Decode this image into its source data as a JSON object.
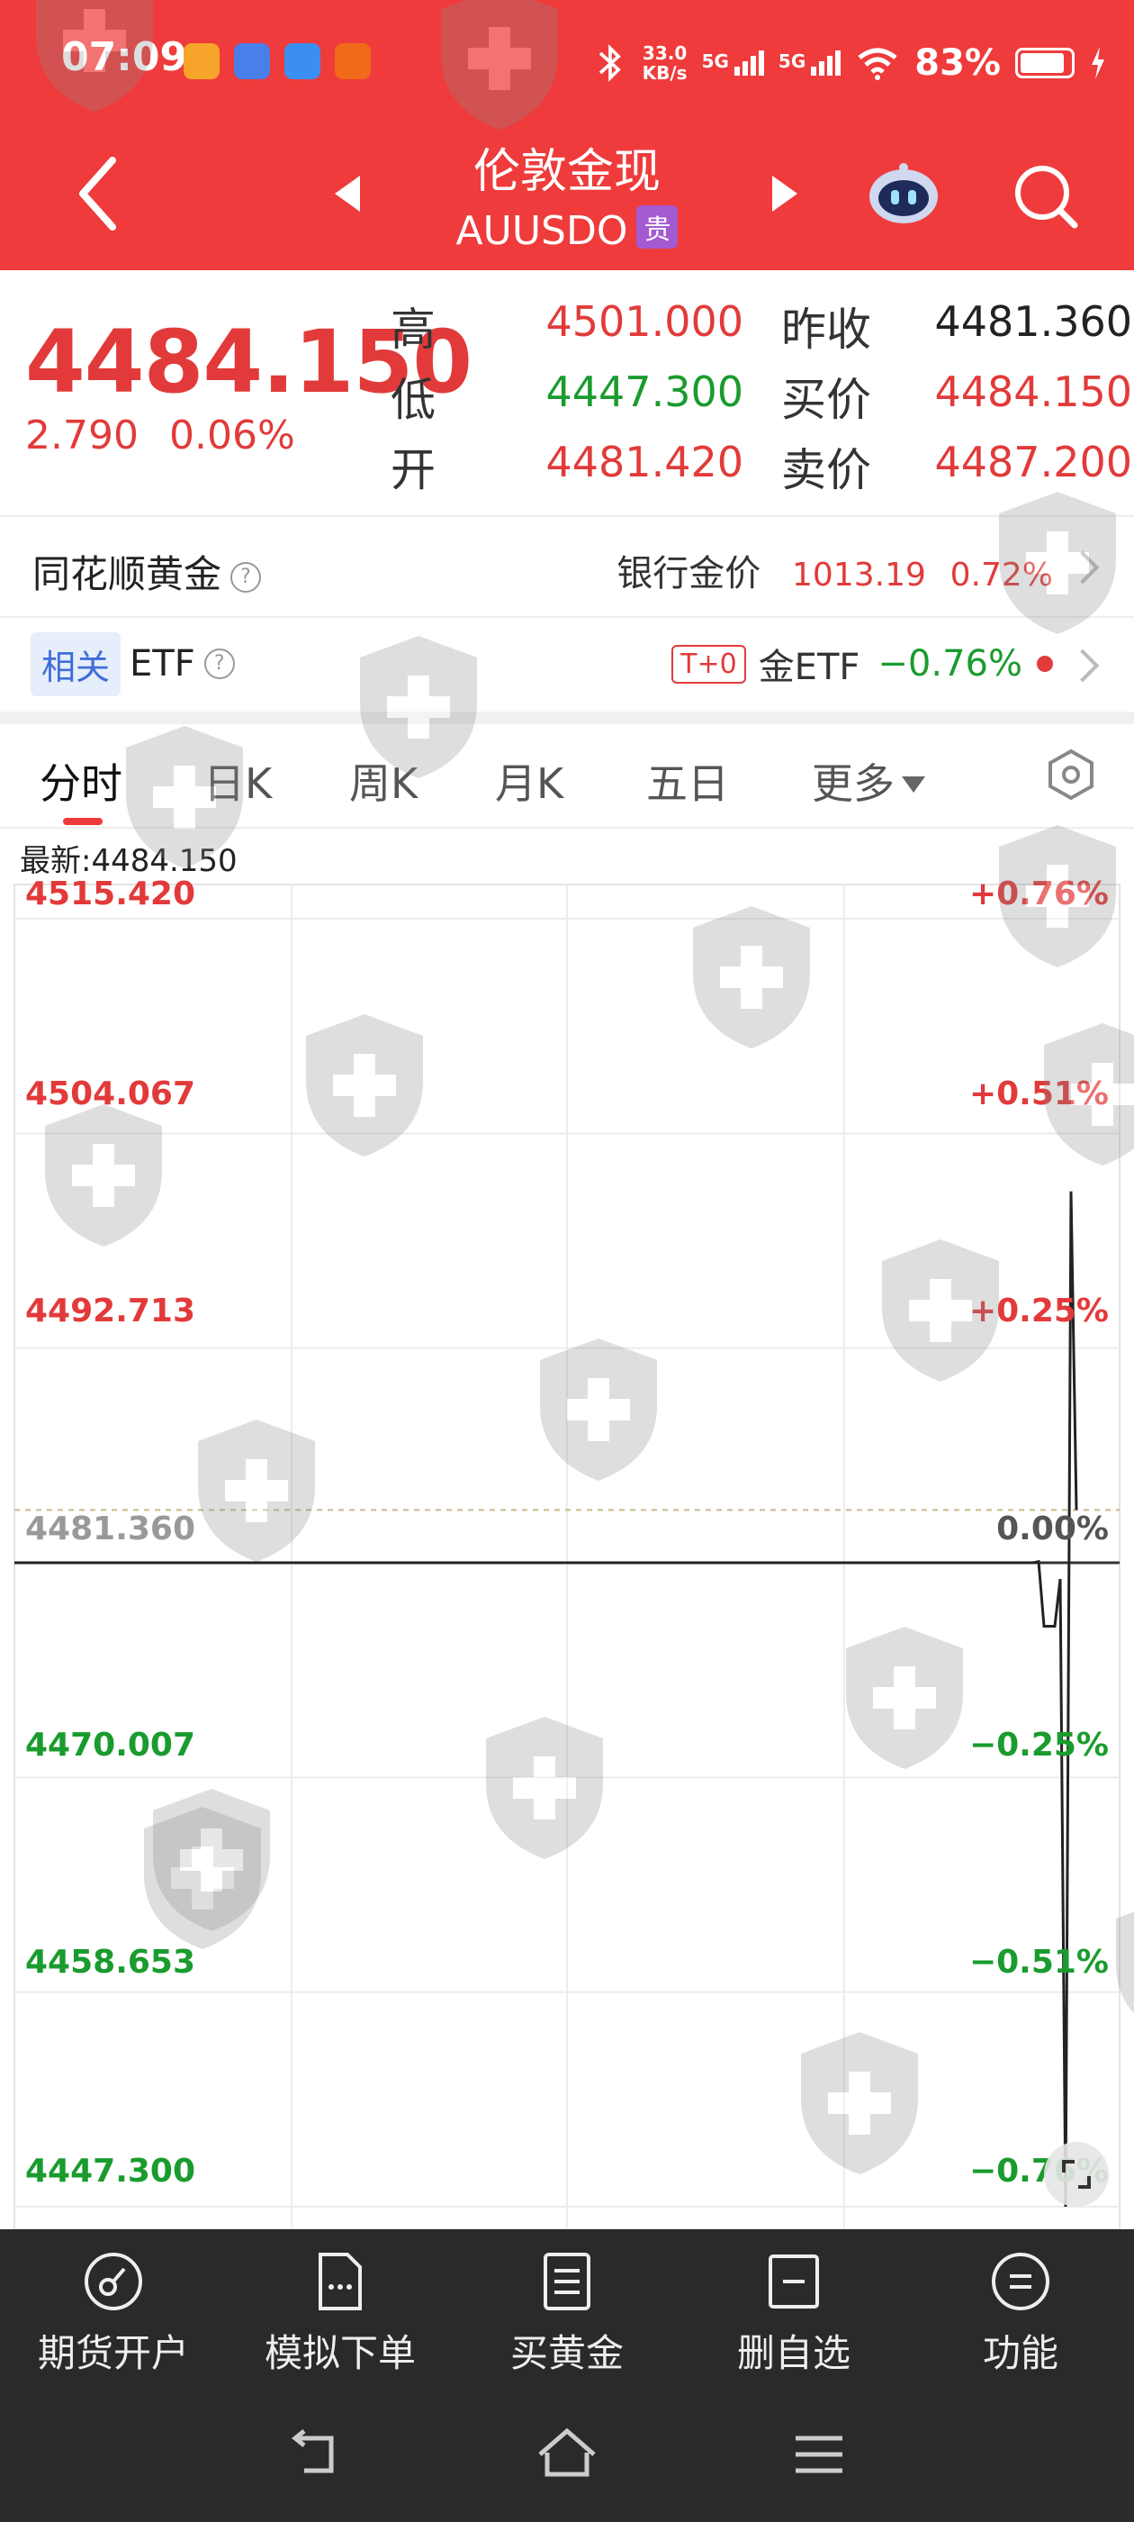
{
  "status_bar": {
    "time": "07:09",
    "net_speed_value": "33.0",
    "net_speed_unit": "KB/s",
    "signal1_label": "5G",
    "signal2_label": "5G",
    "battery": "83%"
  },
  "header": {
    "title": "伦敦金现",
    "subtitle": "AUUSDO",
    "badge": "贵"
  },
  "quote": {
    "last_price": "4484.150",
    "change": "2.790",
    "change_pct": "0.06%",
    "high_label": "高",
    "high": "4501.000",
    "low_label": "低",
    "low": "4447.300",
    "open_label": "开",
    "open": "4481.420",
    "prev_close_label": "昨收",
    "prev_close": "4481.360",
    "bid_label": "买价",
    "bid": "4484.150",
    "ask_label": "卖价",
    "ask": "4487.200"
  },
  "gold_row": {
    "label": "同花顺黄金",
    "bank_label": "银行金价",
    "bank_price": "1013.19",
    "bank_pct": "0.72%"
  },
  "etf_row": {
    "tag": "相关",
    "label": "ETF",
    "t0": "T+0",
    "etf_name": "金ETF",
    "etf_pct": "−0.76%"
  },
  "tabs": [
    "分时",
    "日K",
    "周K",
    "月K",
    "五日",
    "更多"
  ],
  "latest": "最新:4484.150",
  "colors": {
    "up": "#e23a3a",
    "down": "#1a9b2e",
    "header_bg": "#ef3b3b",
    "footer_bg": "#2a2a2a"
  },
  "chart_data": {
    "type": "line",
    "y_labels_left": [
      "4515.420",
      "4504.067",
      "4492.713",
      "4481.360",
      "4470.007",
      "4458.653",
      "4447.300"
    ],
    "y_labels_right": [
      "+0.76%",
      "+0.51%",
      "+0.25%",
      "0.00%",
      "−0.25%",
      "−0.51%",
      "−0.76%"
    ],
    "ylim": [
      4447.3,
      4515.42
    ],
    "reference": 4481.36,
    "average_line": 4484.15,
    "grid": true,
    "series": [
      {
        "values": [
          4481.36,
          4481.36,
          4481.36,
          4481.36,
          4481.36,
          4481.36,
          4481.36,
          4481.36,
          4481.36,
          4481.36,
          4481.36,
          4481.36,
          4481.36,
          4481.36,
          4481.36,
          4481.36,
          4481.36,
          4481.36,
          4481.36,
          4481.36,
          4481.36,
          4481.36,
          4481.36,
          4481.36,
          4481.36,
          4481.36,
          4481.36,
          4481.36,
          4481.36,
          4481.36,
          4481.36,
          4481.36,
          4481.36,
          4481.36,
          4481.36,
          4481.36,
          4481.36,
          4481.36,
          4481.36,
          4481.36,
          4481.36,
          4481.36,
          4481.36,
          4481.36,
          4481.36,
          4481.36,
          4481.36,
          4481.36,
          4481.36,
          4481.36,
          4481.36,
          4481.36,
          4481.36,
          4481.36,
          4481.36,
          4481.36,
          4481.36,
          4481.36,
          4481.36,
          4481.36,
          4481.36,
          4481.36,
          4481.42,
          4478.0,
          4478.0,
          4478.0,
          4480.5,
          4447.3,
          4501.0,
          4484.15
        ]
      }
    ]
  },
  "bottom_nav": [
    "期货开户",
    "模拟下单",
    "买黄金",
    "删自选",
    "功能"
  ]
}
